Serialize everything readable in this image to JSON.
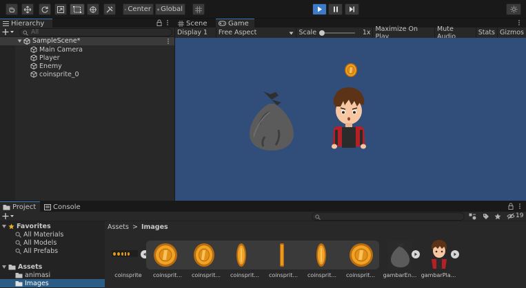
{
  "toolbar": {
    "pivot_label": "Center",
    "space_label": "Global",
    "tools": [
      "hand-tool",
      "move-tool",
      "rotate-tool",
      "scale-tool",
      "rect-tool",
      "transform-tool",
      "custom-tool"
    ]
  },
  "hierarchy": {
    "tab_label": "Hierarchy",
    "search_placeholder": "All",
    "scene_name": "SampleScene*",
    "items": [
      "Main Camera",
      "Player",
      "Enemy",
      "coinsprite_0"
    ]
  },
  "scene_tab": "Scene",
  "game_tab": "Game",
  "game_toolbar": {
    "display": "Display 1",
    "aspect": "Free Aspect",
    "scale_label": "Scale",
    "scale_value": "1x",
    "maximize": "Maximize On Play",
    "mute": "Mute Audio",
    "stats": "Stats",
    "gizmos": "Gizmos",
    "scale_fraction": 0.0
  },
  "project": {
    "tab_label": "Project",
    "console_label": "Console",
    "breadcrumb_root": "Assets",
    "breadcrumb_sep": ">",
    "breadcrumb_current": "Images",
    "hidden_count": "19",
    "favorites_label": "Favorites",
    "favorites": [
      "All Materials",
      "All Models",
      "All Prefabs"
    ],
    "assets_label": "Assets",
    "folders": [
      "animasi",
      "Images"
    ],
    "asset_labels": [
      "coinsprite",
      "coinsprit...",
      "coinsprit...",
      "coinsprit...",
      "coinsprit...",
      "coinsprit...",
      "coinsprit...",
      "gambarEn...",
      "gambarPla..."
    ]
  },
  "colors": {
    "accent": "#3e7bc7",
    "game_bg": "#314d79",
    "coin": "#e8a21e",
    "panel": "#282828"
  }
}
